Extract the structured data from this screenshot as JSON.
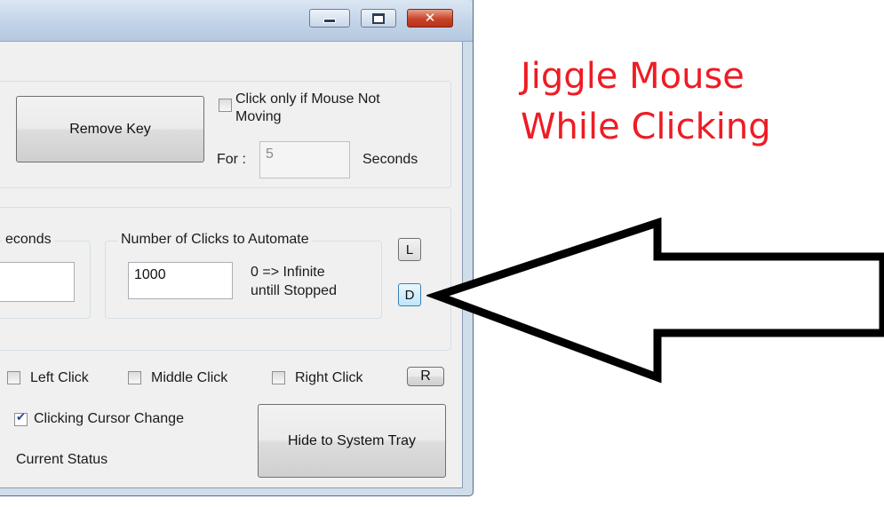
{
  "window": {
    "controls": {
      "minimize": "minimize",
      "maximize": "maximize",
      "close": "close"
    },
    "key_group": {
      "remove_key_label": "Remove Key",
      "click_only_if_label": "Click only if Mouse Not Moving",
      "for_label": "For :",
      "for_value": "5",
      "seconds_label": "Seconds"
    },
    "timing_group": {
      "seconds_legend_fragment": "econds",
      "clicks_legend": "Number of Clicks to Automate",
      "clicks_value": "1000",
      "infinite_hint_line1": "0 => Infinite",
      "infinite_hint_line2": "untill Stopped",
      "l_button": "L",
      "d_button": "D"
    },
    "click_types": {
      "left": {
        "label": "Left Click",
        "checked": false
      },
      "middle": {
        "label": "Middle Click",
        "checked": false
      },
      "right": {
        "label": "Right Click",
        "checked": false
      },
      "r_button": "R"
    },
    "cursor_change": {
      "label": "Clicking Cursor Change",
      "checked": true
    },
    "status_label": "Current Status",
    "hide_tray_label": "Hide to System Tray"
  },
  "annotation": {
    "line1": "Jiggle Mouse",
    "line2": "While Clicking",
    "color": "#ee1c24"
  }
}
